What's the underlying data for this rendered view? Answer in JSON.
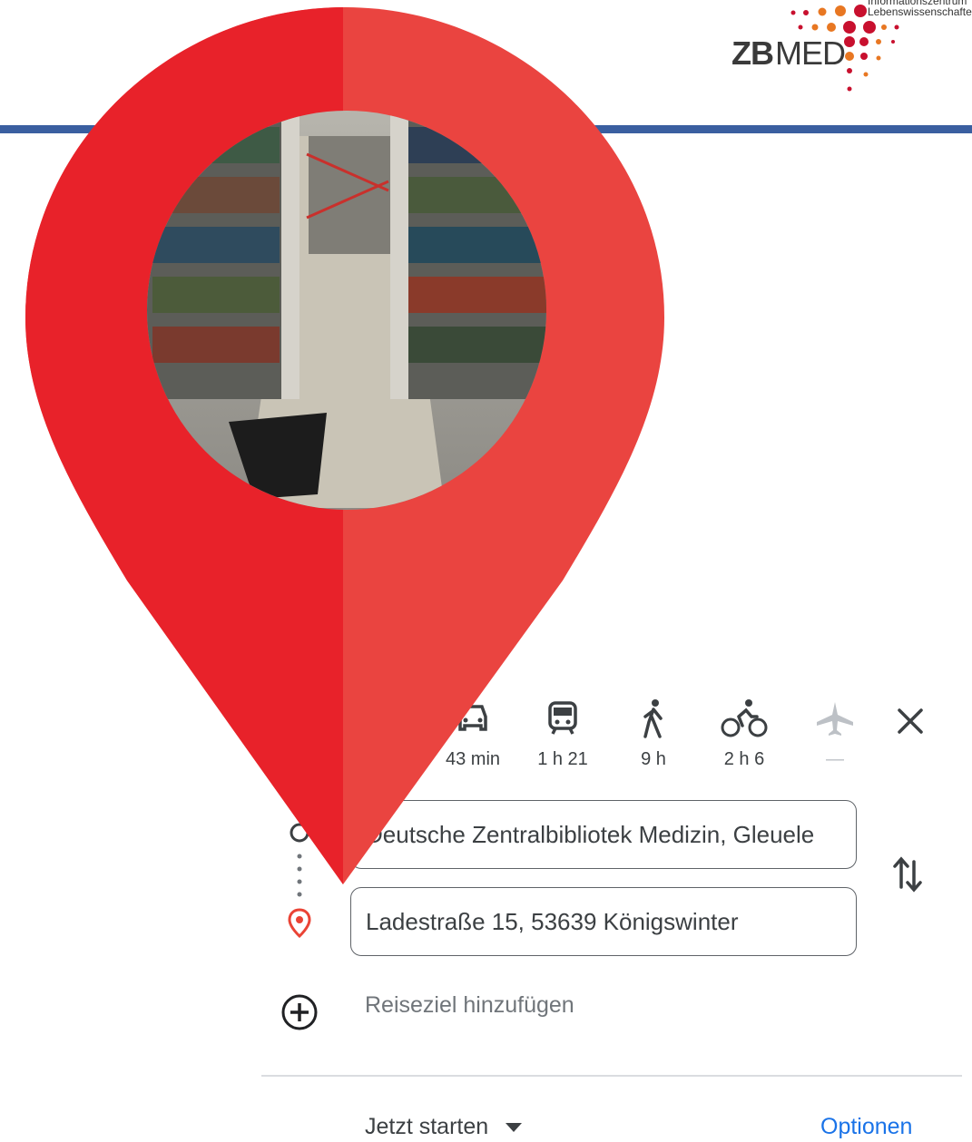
{
  "logo": {
    "text_bold": "ZB",
    "text_light": "MED",
    "tagline_1": "Informationszentrum",
    "tagline_2": "Lebenswissenschaften",
    "colors": [
      "#c8102e",
      "#e87722"
    ]
  },
  "header_bar_color": "#3a5fa0",
  "pin": {
    "color_left": "#e8222a",
    "color_right": "#ea4440",
    "photo_subject": "library shelves photo"
  },
  "travel_modes": [
    {
      "name": "car-icon",
      "time": "43 min"
    },
    {
      "name": "train-icon",
      "time": "1 h 21"
    },
    {
      "name": "walk-icon",
      "time": "9 h"
    },
    {
      "name": "bike-icon",
      "time": "2 h 6"
    },
    {
      "name": "plane-icon",
      "time": "—"
    }
  ],
  "route": {
    "origin": "Deutsche Zentralbibliotek Medizin, Gleuele",
    "destination": "Ladestraße 15, 53639 Königswinter",
    "add_destination": "Reiseziel hinzufügen"
  },
  "footer": {
    "start_now": "Jetzt starten",
    "options": "Optionen"
  },
  "accent_colors": {
    "link": "#1a73e8",
    "destination_pin": "#ea4335"
  }
}
